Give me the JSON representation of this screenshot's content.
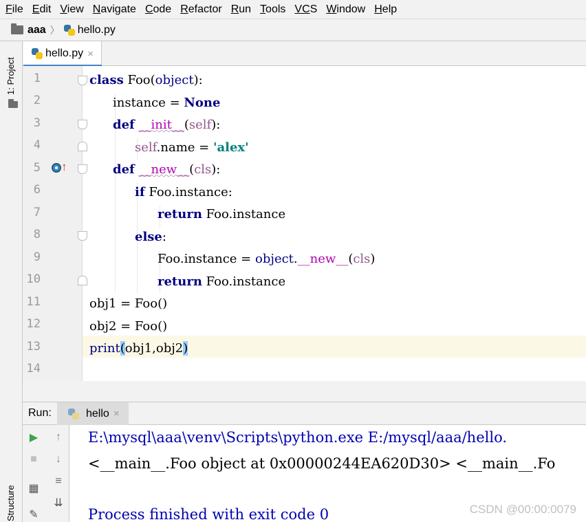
{
  "menu": [
    {
      "key": "F",
      "rest": "ile"
    },
    {
      "key": "E",
      "rest": "dit"
    },
    {
      "key": "V",
      "rest": "iew"
    },
    {
      "key": "N",
      "rest": "avigate"
    },
    {
      "key": "C",
      "rest": "ode"
    },
    {
      "key": "R",
      "rest": "efactor"
    },
    {
      "key": "R",
      "rest": "un"
    },
    {
      "key": "T",
      "rest": "ools"
    },
    {
      "key": "VC",
      "rest": "S"
    },
    {
      "key": "W",
      "rest": "indow"
    },
    {
      "key": "H",
      "rest": "elp"
    }
  ],
  "breadcrumb": {
    "project": "aaa",
    "file": "hello.py"
  },
  "left_strip": {
    "project_tab": "1: Project",
    "structure_tab": "Structure"
  },
  "editor_tab": {
    "label": "hello.py",
    "close": "×"
  },
  "line_numbers": [
    "1",
    "2",
    "3",
    "4",
    "5",
    "6",
    "7",
    "8",
    "9",
    "10",
    "11",
    "12",
    "13",
    "14"
  ],
  "code": {
    "l1": {
      "kw": "class",
      "name": " Foo",
      "open": "(",
      "base": "object",
      "close": "):"
    },
    "l2": {
      "a": "instance = ",
      "none": "None"
    },
    "l3": {
      "kw": "def",
      "sp": " ",
      "fn": "__init__",
      "open": "(",
      "self": "self",
      "close": "):"
    },
    "l4": {
      "self": "self",
      "mid": ".name = ",
      "str": "'alex'"
    },
    "l5": {
      "kw": "def",
      "sp": " ",
      "fn": "__new__",
      "open": "(",
      "cls": "cls",
      "close": "):"
    },
    "l6": {
      "kw": "if",
      "rest": " Foo.instance:"
    },
    "l7": {
      "kw": "return",
      "rest": " Foo.instance"
    },
    "l8": {
      "kw": "else",
      "rest": ":"
    },
    "l9": {
      "a": "Foo.instance = ",
      "obj": "object",
      "dot": ".",
      "fn": "__new__",
      "open": "(",
      "cls": "cls",
      "close": ")"
    },
    "l10": {
      "kw": "return",
      "rest": " Foo.instance"
    },
    "l11": {
      "text": "obj1 = Foo()"
    },
    "l12": {
      "text": "obj2 = Foo()"
    },
    "l13": {
      "fn": "print",
      "open": "(",
      "args": "obj1,obj2",
      "close": ")"
    }
  },
  "run_panel": {
    "label": "Run:",
    "tab": "hello",
    "close": "×"
  },
  "console": {
    "line1": "E:\\mysql\\aaa\\venv\\Scripts\\python.exe E:/mysql/aaa/hello.",
    "line2": "<__main__.Foo object at 0x00000244EA620D30> <__main__.Fo",
    "line3": "Process finished with exit code 0"
  },
  "watermark": "CSDN @00:00:0079",
  "colors": {
    "keyword": "#000080",
    "self": "#94558d",
    "string": "#008080",
    "magic": "#b200b2",
    "console_blue": "#0000b0",
    "current_line": "#fcf8e6"
  }
}
